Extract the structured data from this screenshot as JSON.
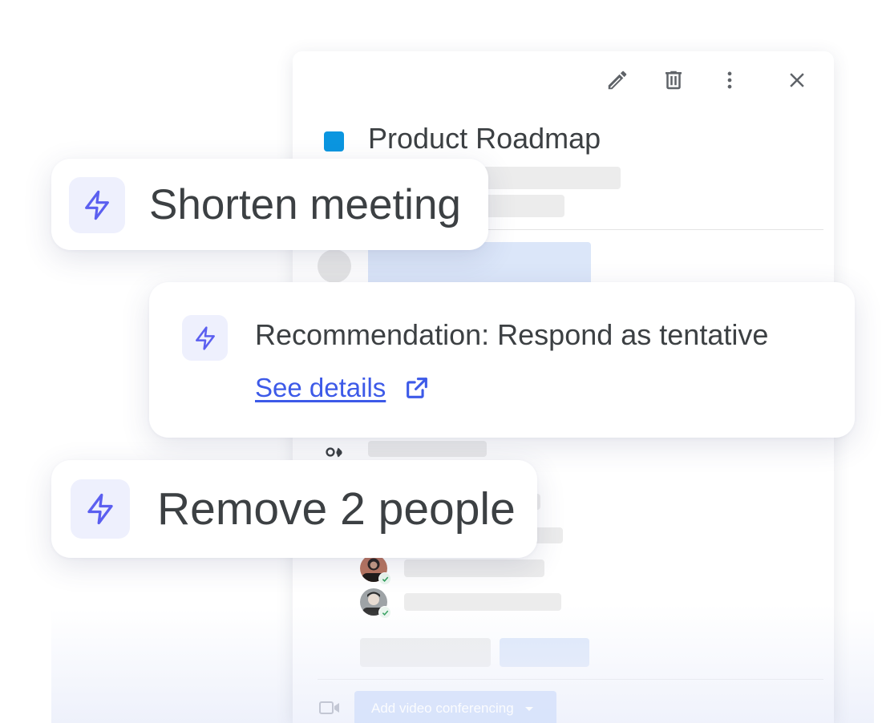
{
  "colors": {
    "accent": "#5b5ff0",
    "badge_bg": "#eef0fd",
    "link": "#3d5ae8",
    "event_color": "#0b96e0",
    "text": "#3c4043"
  },
  "event": {
    "title": "Product Roadmap",
    "toolbar": {
      "icons": [
        "pencil-icon",
        "trash-icon",
        "more-vert-icon",
        "close-icon"
      ]
    },
    "video_button_label": "Add video conferencing",
    "attendee_avatars": 2
  },
  "suggestions": {
    "shorten": {
      "icon": "lightning-bolt-icon",
      "label": "Shorten meeting"
    },
    "recommendation": {
      "icon": "lightning-bolt-icon",
      "text": "Recommendation: Respond as tentative",
      "link_label": "See details",
      "link_icon": "external-link-icon"
    },
    "remove": {
      "icon": "lightning-bolt-icon",
      "label": "Remove 2 people"
    }
  }
}
